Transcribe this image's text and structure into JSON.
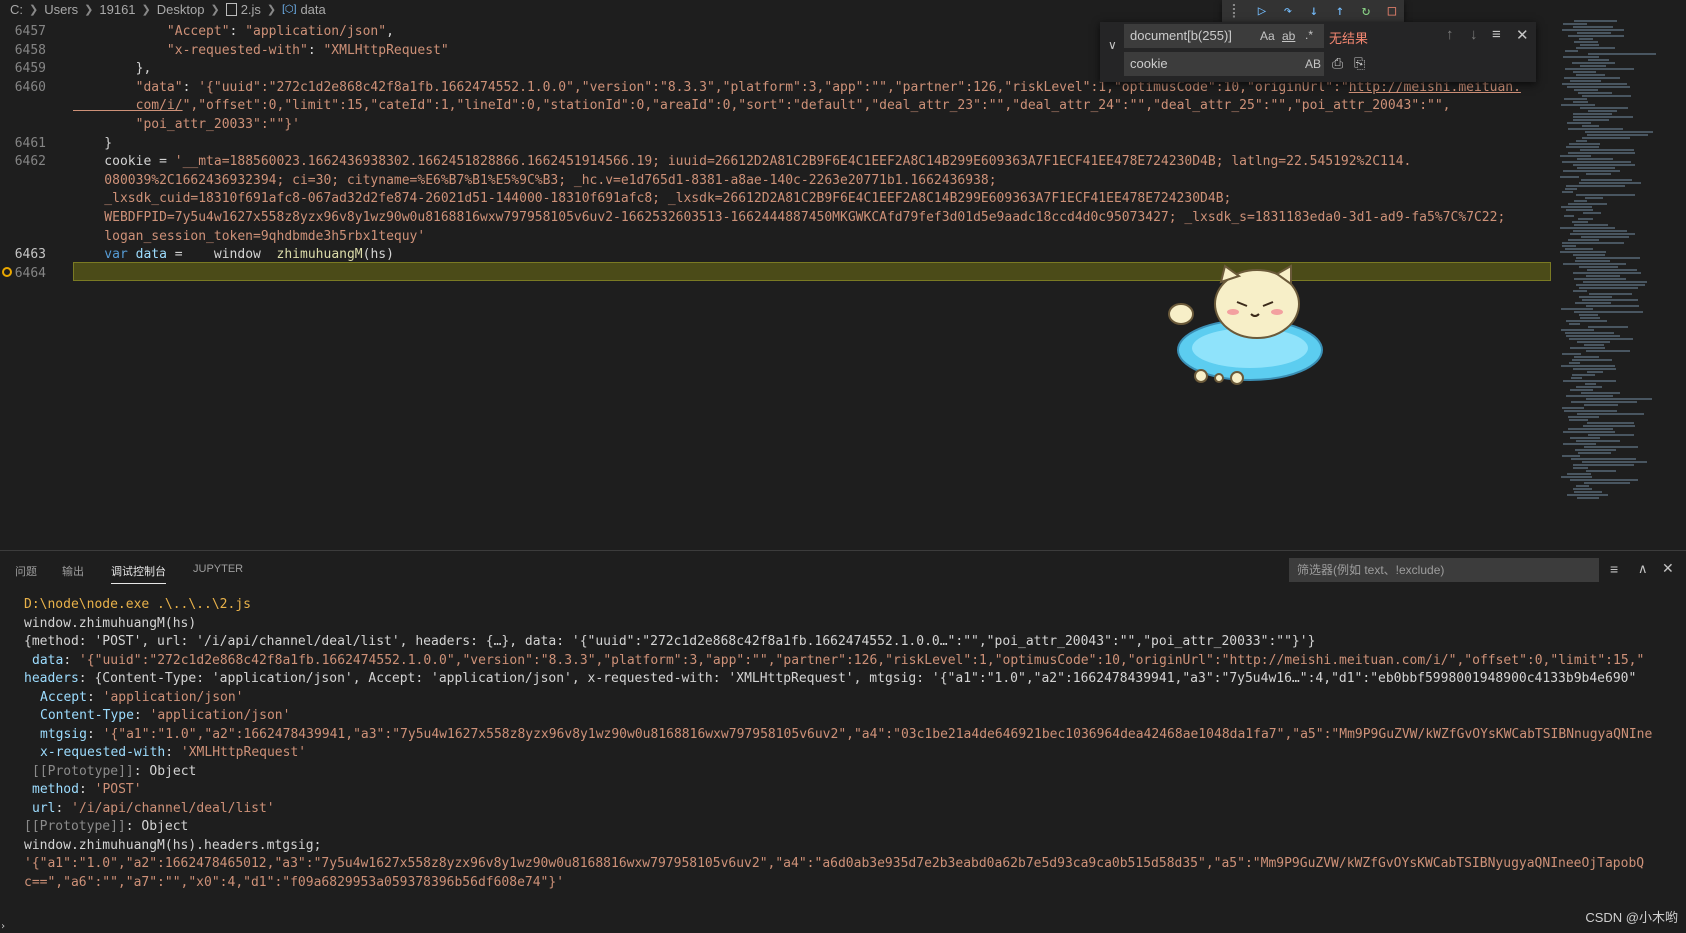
{
  "breadcrumb": {
    "items": [
      "C:",
      "Users",
      "19161",
      "Desktop",
      "2.js",
      "data"
    ]
  },
  "editor": {
    "lines": [
      {
        "num": "6457",
        "parts": [
          [
            "str",
            "            \"Accept\""
          ],
          [
            "plain",
            ": "
          ],
          [
            "str",
            "\"application/json\""
          ],
          [
            "plain",
            ","
          ]
        ]
      },
      {
        "num": "6458",
        "parts": [
          [
            "str",
            "            \"x-requested-with\""
          ],
          [
            "plain",
            ": "
          ],
          [
            "str",
            "\"XMLHttpRequest\""
          ]
        ]
      },
      {
        "num": "6459",
        "parts": [
          [
            "plain",
            "        },"
          ]
        ]
      },
      {
        "num": "6460",
        "parts": [
          [
            "str",
            "        \"data\""
          ],
          [
            "plain",
            ": "
          ],
          [
            "str",
            "'{\"uuid\":\"272c1d2e868c42f8a1fb.1662474552.1.0.0\",\"version\":\"8.3.3\",\"platform\":3,\"app\":\"\",\"partner\":126,\"riskLevel\":1,\"optimusCode\":10,\"originUrl\":\""
          ],
          [
            "link",
            "http://meishi.meituan."
          ]
        ]
      },
      {
        "num": "",
        "parts": [
          [
            "link",
            "        com/i/"
          ],
          [
            "str",
            "\",\"offset\":0,\"limit\":15,\"cateId\":1,\"lineId\":0,\"stationId\":0,\"areaId\":0,\"sort\":\"default\",\"deal_attr_23\":\"\",\"deal_attr_24\":\"\",\"deal_attr_25\":\"\",\"poi_attr_20043\":\"\","
          ]
        ]
      },
      {
        "num": "",
        "parts": [
          [
            "str",
            "        \"poi_attr_20033\":\"\"}'"
          ]
        ]
      },
      {
        "num": "6461",
        "parts": [
          [
            "plain",
            "    }"
          ]
        ]
      },
      {
        "num": "6462",
        "parts": [
          [
            "plain",
            "    cookie = "
          ],
          [
            "str",
            "'__mta=188560023.1662436938302.1662451828866.1662451914566.19; iuuid=26612D2A81C2B9F6E4C1EEF2A8C14B299E609363A7F1ECF41EE478E724230D4B; latlng=22.545192%2C114."
          ]
        ]
      },
      {
        "num": "",
        "parts": [
          [
            "str",
            "    080039%2C1662436932394; ci=30; cityname=%E6%B7%B1%E5%9C%B3; _hc.v=e1d765d1-8381-a8ae-140c-2263e20771b1.1662436938;"
          ]
        ]
      },
      {
        "num": "",
        "parts": [
          [
            "str",
            "    _lxsdk_cuid=18310f691afc8-067ad32d2fe874-26021d51-144000-18310f691afc8; _lxsdk=26612D2A81C2B9F6E4C1EEF2A8C14B299E609363A7F1ECF41EE478E724230D4B;"
          ]
        ]
      },
      {
        "num": "",
        "parts": [
          [
            "str",
            "    WEBDFPID=7y5u4w1627x558z8yzx96v8y1wz90w0u8168816wxw797958105v6uv2-1662532603513-1662444887450MKGWKCAfd79fef3d01d5e9aadc18ccd4d0c95073427; _lxsdk_s=1831183eda0-3d1-ad9-fa5%7C%7C22;"
          ]
        ]
      },
      {
        "num": "",
        "parts": [
          [
            "str",
            "    logan_session_token=9qhdbmde3h5rbx1tequy'"
          ]
        ]
      },
      {
        "num": "6463",
        "parts": [
          [
            "kw",
            "    var "
          ],
          [
            "var",
            "data"
          ],
          [
            "plain",
            " = "
          ],
          [
            "plain",
            "   window"
          ],
          [
            "plain",
            "  "
          ],
          [
            "fn",
            "zhimuhuangM"
          ],
          [
            "plain",
            "(hs)"
          ]
        ]
      },
      {
        "num": "6464",
        "parts": [
          [
            "plain",
            ""
          ]
        ]
      }
    ]
  },
  "find_widget": {
    "search_value": "document[b(255)]",
    "no_results": "无结果",
    "replace_value": "cookie",
    "match_case": "Aa",
    "whole_word": "ab",
    "regex": ".*",
    "preserve_case": "AB"
  },
  "panel": {
    "tabs": [
      "问题",
      "输出",
      "调试控制台",
      "JUPYTER"
    ],
    "active_tab": "调试控制台",
    "filter_placeholder": "筛选器(例如 text、!exclude)",
    "lines": [
      {
        "indent": 0,
        "arrow": "",
        "parts": [
          [
            "yellow",
            "D:\\node\\node.exe .\\..\\..\\2.js"
          ]
        ]
      },
      {
        "indent": 0,
        "arrow": "›",
        "parts": [
          [
            "plain",
            "window.zhimuhuangM(hs)"
          ]
        ]
      },
      {
        "indent": 0,
        "arrow": "∨",
        "parts": [
          [
            "plain",
            "{method: 'POST', url: '/i/api/channel/deal/list', headers: {…}, data: '{\"uuid\":\"272c1d2e868c42f8a1fb.1662474552.1.0.0…\":\"\",\"poi_attr_20043\":\"\",\"poi_attr_20033\":\"\"}'}"
          ]
        ]
      },
      {
        "indent": 1,
        "arrow": "",
        "parts": [
          [
            "var",
            "data"
          ],
          [
            "plain",
            ": "
          ],
          [
            "str",
            "'{\"uuid\":\"272c1d2e868c42f8a1fb.1662474552.1.0.0\",\"version\":\"8.3.3\",\"platform\":3,\"app\":\"\",\"partner\":126,\"riskLevel\":1,\"optimusCode\":10,\"originUrl\":\"http://meishi.meituan.com/i/\",\"offset\":0,\"limit\":15,\""
          ]
        ]
      },
      {
        "indent": 0,
        "arrow": "∨",
        "parts": [
          [
            "var",
            "headers"
          ],
          [
            "plain",
            ": {Content-Type: 'application/json', Accept: 'application/json', x-requested-with: 'XMLHttpRequest', mtgsig: '{\"a1\":\"1.0\",\"a2\":1662478439941,\"a3\":\"7y5u4w16…\":4,\"d1\":\"eb0bbf5998001948900c4133b9b4e690\""
          ]
        ]
      },
      {
        "indent": 2,
        "arrow": "",
        "parts": [
          [
            "var",
            "Accept"
          ],
          [
            "plain",
            ": "
          ],
          [
            "str",
            "'application/json'"
          ]
        ]
      },
      {
        "indent": 2,
        "arrow": "",
        "parts": [
          [
            "var",
            "Content-Type"
          ],
          [
            "plain",
            ": "
          ],
          [
            "str",
            "'application/json'"
          ]
        ]
      },
      {
        "indent": 2,
        "arrow": "",
        "parts": [
          [
            "var",
            "mtgsig"
          ],
          [
            "plain",
            ": "
          ],
          [
            "str",
            "'{\"a1\":\"1.0\",\"a2\":1662478439941,\"a3\":\"7y5u4w1627x558z8yzx96v8y1wz90w0u8168816wxw797958105v6uv2\",\"a4\":\"03c1be21a4de646921bec1036964dea42468ae1048da1fa7\",\"a5\":\"Mm9P9GuZVW/kWZfGvOYsKWCabTSIBNnugyaQNIne"
          ]
        ]
      },
      {
        "indent": 2,
        "arrow": "",
        "parts": [
          [
            "var",
            "x-requested-with"
          ],
          [
            "plain",
            ": "
          ],
          [
            "str",
            "'XMLHttpRequest'"
          ]
        ]
      },
      {
        "indent": 1,
        "arrow": "›",
        "parts": [
          [
            "grey",
            "[[Prototype]]"
          ],
          [
            "plain",
            ": Object"
          ]
        ]
      },
      {
        "indent": 1,
        "arrow": "",
        "parts": [
          [
            "var",
            "method"
          ],
          [
            "plain",
            ": "
          ],
          [
            "str",
            "'POST'"
          ]
        ]
      },
      {
        "indent": 1,
        "arrow": "",
        "parts": [
          [
            "var",
            "url"
          ],
          [
            "plain",
            ": "
          ],
          [
            "str",
            "'/i/api/channel/deal/list'"
          ]
        ]
      },
      {
        "indent": 0,
        "arrow": "›",
        "parts": [
          [
            "grey",
            "[[Prototype]]"
          ],
          [
            "plain",
            ": Object"
          ]
        ]
      },
      {
        "indent": 0,
        "arrow": "›",
        "parts": [
          [
            "plain",
            "window.zhimuhuangM(hs).headers.mtgsig;"
          ]
        ]
      },
      {
        "indent": 0,
        "arrow": "",
        "parts": [
          [
            "str",
            "'{\"a1\":\"1.0\",\"a2\":1662478465012,\"a3\":\"7y5u4w1627x558z8yzx96v8y1wz90w0u8168816wxw797958105v6uv2\",\"a4\":\"a6d0ab3e935d7e2b3eabd0a62b7e5d93ca9ca0b515d58d35\",\"a5\":\"Mm9P9GuZVW/kWZfGvOYsKWCabTSIBNyugyaQNIneeOjTapobQ"
          ]
        ]
      },
      {
        "indent": 0,
        "arrow": "",
        "parts": [
          [
            "str",
            "c==\",\"a6\":\"\",\"a7\":\"\",\"x0\":4,\"d1\":\"f09a6829953a059378396b56df608e74\"}'"
          ]
        ]
      }
    ]
  },
  "watermark": "CSDN @小木哟"
}
